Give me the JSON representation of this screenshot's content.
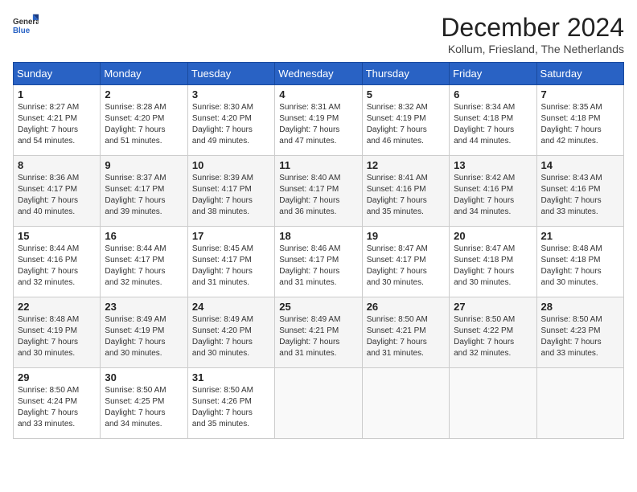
{
  "logo": {
    "general": "General",
    "blue": "Blue"
  },
  "header": {
    "title": "December 2024",
    "location": "Kollum, Friesland, The Netherlands"
  },
  "weekdays": [
    "Sunday",
    "Monday",
    "Tuesday",
    "Wednesday",
    "Thursday",
    "Friday",
    "Saturday"
  ],
  "weeks": [
    [
      {
        "day": "1",
        "lines": [
          "Sunrise: 8:27 AM",
          "Sunset: 4:21 PM",
          "Daylight: 7 hours",
          "and 54 minutes."
        ]
      },
      {
        "day": "2",
        "lines": [
          "Sunrise: 8:28 AM",
          "Sunset: 4:20 PM",
          "Daylight: 7 hours",
          "and 51 minutes."
        ]
      },
      {
        "day": "3",
        "lines": [
          "Sunrise: 8:30 AM",
          "Sunset: 4:20 PM",
          "Daylight: 7 hours",
          "and 49 minutes."
        ]
      },
      {
        "day": "4",
        "lines": [
          "Sunrise: 8:31 AM",
          "Sunset: 4:19 PM",
          "Daylight: 7 hours",
          "and 47 minutes."
        ]
      },
      {
        "day": "5",
        "lines": [
          "Sunrise: 8:32 AM",
          "Sunset: 4:19 PM",
          "Daylight: 7 hours",
          "and 46 minutes."
        ]
      },
      {
        "day": "6",
        "lines": [
          "Sunrise: 8:34 AM",
          "Sunset: 4:18 PM",
          "Daylight: 7 hours",
          "and 44 minutes."
        ]
      },
      {
        "day": "7",
        "lines": [
          "Sunrise: 8:35 AM",
          "Sunset: 4:18 PM",
          "Daylight: 7 hours",
          "and 42 minutes."
        ]
      }
    ],
    [
      {
        "day": "8",
        "lines": [
          "Sunrise: 8:36 AM",
          "Sunset: 4:17 PM",
          "Daylight: 7 hours",
          "and 40 minutes."
        ]
      },
      {
        "day": "9",
        "lines": [
          "Sunrise: 8:37 AM",
          "Sunset: 4:17 PM",
          "Daylight: 7 hours",
          "and 39 minutes."
        ]
      },
      {
        "day": "10",
        "lines": [
          "Sunrise: 8:39 AM",
          "Sunset: 4:17 PM",
          "Daylight: 7 hours",
          "and 38 minutes."
        ]
      },
      {
        "day": "11",
        "lines": [
          "Sunrise: 8:40 AM",
          "Sunset: 4:17 PM",
          "Daylight: 7 hours",
          "and 36 minutes."
        ]
      },
      {
        "day": "12",
        "lines": [
          "Sunrise: 8:41 AM",
          "Sunset: 4:16 PM",
          "Daylight: 7 hours",
          "and 35 minutes."
        ]
      },
      {
        "day": "13",
        "lines": [
          "Sunrise: 8:42 AM",
          "Sunset: 4:16 PM",
          "Daylight: 7 hours",
          "and 34 minutes."
        ]
      },
      {
        "day": "14",
        "lines": [
          "Sunrise: 8:43 AM",
          "Sunset: 4:16 PM",
          "Daylight: 7 hours",
          "and 33 minutes."
        ]
      }
    ],
    [
      {
        "day": "15",
        "lines": [
          "Sunrise: 8:44 AM",
          "Sunset: 4:16 PM",
          "Daylight: 7 hours",
          "and 32 minutes."
        ]
      },
      {
        "day": "16",
        "lines": [
          "Sunrise: 8:44 AM",
          "Sunset: 4:17 PM",
          "Daylight: 7 hours",
          "and 32 minutes."
        ]
      },
      {
        "day": "17",
        "lines": [
          "Sunrise: 8:45 AM",
          "Sunset: 4:17 PM",
          "Daylight: 7 hours",
          "and 31 minutes."
        ]
      },
      {
        "day": "18",
        "lines": [
          "Sunrise: 8:46 AM",
          "Sunset: 4:17 PM",
          "Daylight: 7 hours",
          "and 31 minutes."
        ]
      },
      {
        "day": "19",
        "lines": [
          "Sunrise: 8:47 AM",
          "Sunset: 4:17 PM",
          "Daylight: 7 hours",
          "and 30 minutes."
        ]
      },
      {
        "day": "20",
        "lines": [
          "Sunrise: 8:47 AM",
          "Sunset: 4:18 PM",
          "Daylight: 7 hours",
          "and 30 minutes."
        ]
      },
      {
        "day": "21",
        "lines": [
          "Sunrise: 8:48 AM",
          "Sunset: 4:18 PM",
          "Daylight: 7 hours",
          "and 30 minutes."
        ]
      }
    ],
    [
      {
        "day": "22",
        "lines": [
          "Sunrise: 8:48 AM",
          "Sunset: 4:19 PM",
          "Daylight: 7 hours",
          "and 30 minutes."
        ]
      },
      {
        "day": "23",
        "lines": [
          "Sunrise: 8:49 AM",
          "Sunset: 4:19 PM",
          "Daylight: 7 hours",
          "and 30 minutes."
        ]
      },
      {
        "day": "24",
        "lines": [
          "Sunrise: 8:49 AM",
          "Sunset: 4:20 PM",
          "Daylight: 7 hours",
          "and 30 minutes."
        ]
      },
      {
        "day": "25",
        "lines": [
          "Sunrise: 8:49 AM",
          "Sunset: 4:21 PM",
          "Daylight: 7 hours",
          "and 31 minutes."
        ]
      },
      {
        "day": "26",
        "lines": [
          "Sunrise: 8:50 AM",
          "Sunset: 4:21 PM",
          "Daylight: 7 hours",
          "and 31 minutes."
        ]
      },
      {
        "day": "27",
        "lines": [
          "Sunrise: 8:50 AM",
          "Sunset: 4:22 PM",
          "Daylight: 7 hours",
          "and 32 minutes."
        ]
      },
      {
        "day": "28",
        "lines": [
          "Sunrise: 8:50 AM",
          "Sunset: 4:23 PM",
          "Daylight: 7 hours",
          "and 33 minutes."
        ]
      }
    ],
    [
      {
        "day": "29",
        "lines": [
          "Sunrise: 8:50 AM",
          "Sunset: 4:24 PM",
          "Daylight: 7 hours",
          "and 33 minutes."
        ]
      },
      {
        "day": "30",
        "lines": [
          "Sunrise: 8:50 AM",
          "Sunset: 4:25 PM",
          "Daylight: 7 hours",
          "and 34 minutes."
        ]
      },
      {
        "day": "31",
        "lines": [
          "Sunrise: 8:50 AM",
          "Sunset: 4:26 PM",
          "Daylight: 7 hours",
          "and 35 minutes."
        ]
      },
      null,
      null,
      null,
      null
    ]
  ]
}
